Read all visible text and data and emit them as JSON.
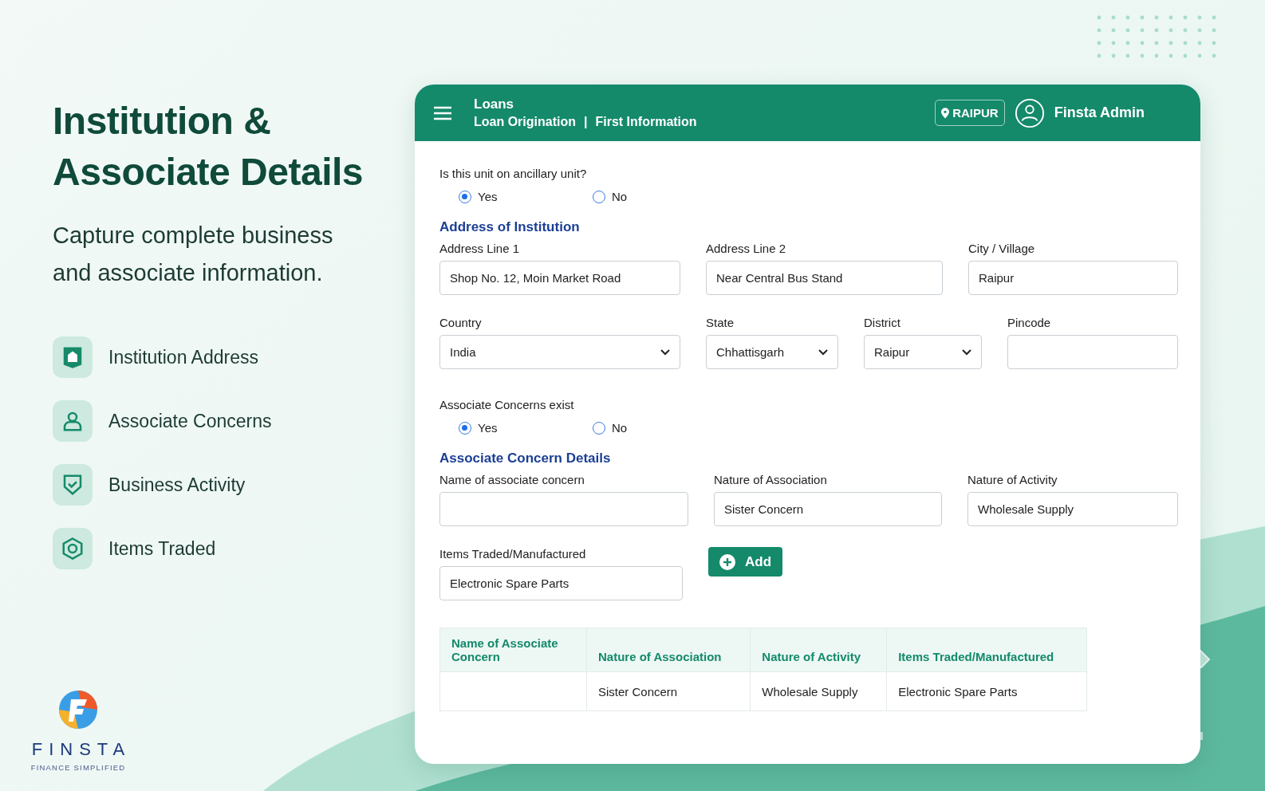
{
  "intro": {
    "title": "Institution & Associate Details",
    "subtitle": "Capture complete business and associate information."
  },
  "features": [
    {
      "kind": "building",
      "label": "Institution Address"
    },
    {
      "kind": "person",
      "label": "Associate Concerns"
    },
    {
      "kind": "shield",
      "label": "Business Activity"
    },
    {
      "kind": "badge",
      "label": "Items Traded"
    }
  ],
  "brand": {
    "name": "FINSTA",
    "tagline": "FINANCE SIMPLIFIED"
  },
  "header": {
    "module": "Loans",
    "breadcrumb": [
      "Loan Origination",
      "First Information"
    ],
    "separator": "|",
    "location": "RAIPUR",
    "user": "Finsta Admin"
  },
  "ancillary": {
    "question": "Is this unit on ancillary unit?",
    "options": [
      {
        "label": "Yes",
        "selected": true
      },
      {
        "label": "No",
        "selected": false
      }
    ]
  },
  "address_section": {
    "heading": "Address of Institution",
    "fields": [
      {
        "kind": "input",
        "label": "Address Line 1",
        "value": "Shop No. 12, Moin Market Road"
      },
      {
        "kind": "input",
        "label": "Address Line 2",
        "value": "Near Central Bus Stand"
      },
      {
        "kind": "input",
        "label": "City / Village",
        "value": "Raipur"
      },
      {
        "kind": "select",
        "label": "Country",
        "value": "India"
      },
      {
        "kind": "select",
        "label": "State",
        "value": "Chhattisgarh"
      },
      {
        "kind": "select",
        "label": "District",
        "value": "Raipur"
      },
      {
        "kind": "input",
        "label": "Pincode"
      }
    ]
  },
  "associate": {
    "question": "Associate Concerns exist",
    "options": [
      {
        "label": "Yes",
        "selected": true
      },
      {
        "label": "No",
        "selected": false
      }
    ]
  },
  "concern_section": {
    "heading": "Associate Concern Details",
    "fields": [
      {
        "kind": "input",
        "label": "Name of associate concern"
      },
      {
        "kind": "input",
        "label": "Nature of Association",
        "value": "Sister Concern"
      },
      {
        "kind": "input",
        "label": "Nature of Activity",
        "value": "Wholesale Supply"
      },
      {
        "kind": "input",
        "label": "Items Traded/Manufactured",
        "value": "Electronic Spare Parts"
      },
      {
        "kind": "button",
        "label": "Add"
      }
    ]
  },
  "table": {
    "columns": [
      "Name of Associate Concern",
      "Nature of Association",
      "Nature of Activity",
      "Items Traded/Manufactured"
    ],
    "rows": [
      [
        null,
        "Sister Concern",
        "Wholesale Supply",
        "Electronic Spare Parts"
      ]
    ]
  }
}
